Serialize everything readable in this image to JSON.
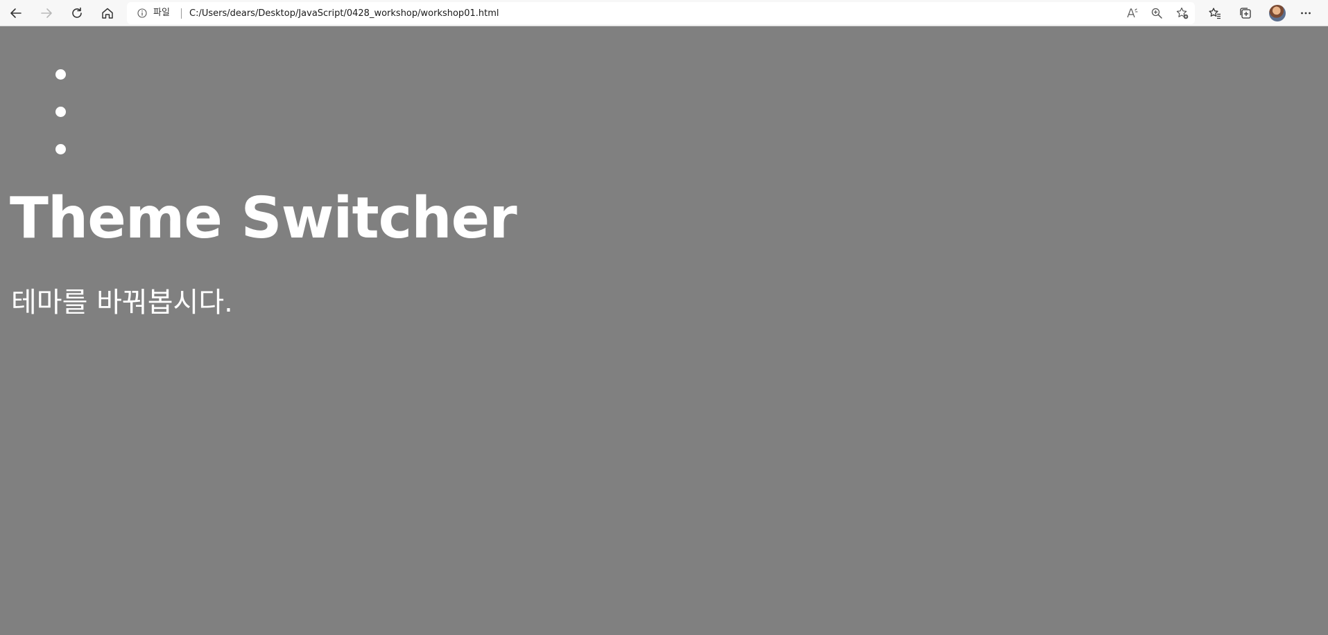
{
  "browser": {
    "scheme_label": "파일",
    "url": "C:/Users/dears/Desktop/JavaScript/0428_workshop/workshop01.html",
    "icons": {
      "back": "back-arrow-icon",
      "forward": "forward-arrow-icon",
      "refresh": "refresh-icon",
      "home": "home-icon",
      "info": "info-icon",
      "read_aloud": "read-aloud-icon",
      "zoom": "zoom-icon",
      "favorite_add": "favorite-add-icon",
      "favorites": "favorites-icon",
      "collections": "collections-icon",
      "profile": "avatar",
      "more": "more-icon"
    }
  },
  "page": {
    "background_color": "#808080",
    "text_color": "#ffffff",
    "list_items": [
      "",
      "",
      ""
    ],
    "title": "Theme Switcher",
    "subtitle": "테마를 바꿔봅시다."
  }
}
